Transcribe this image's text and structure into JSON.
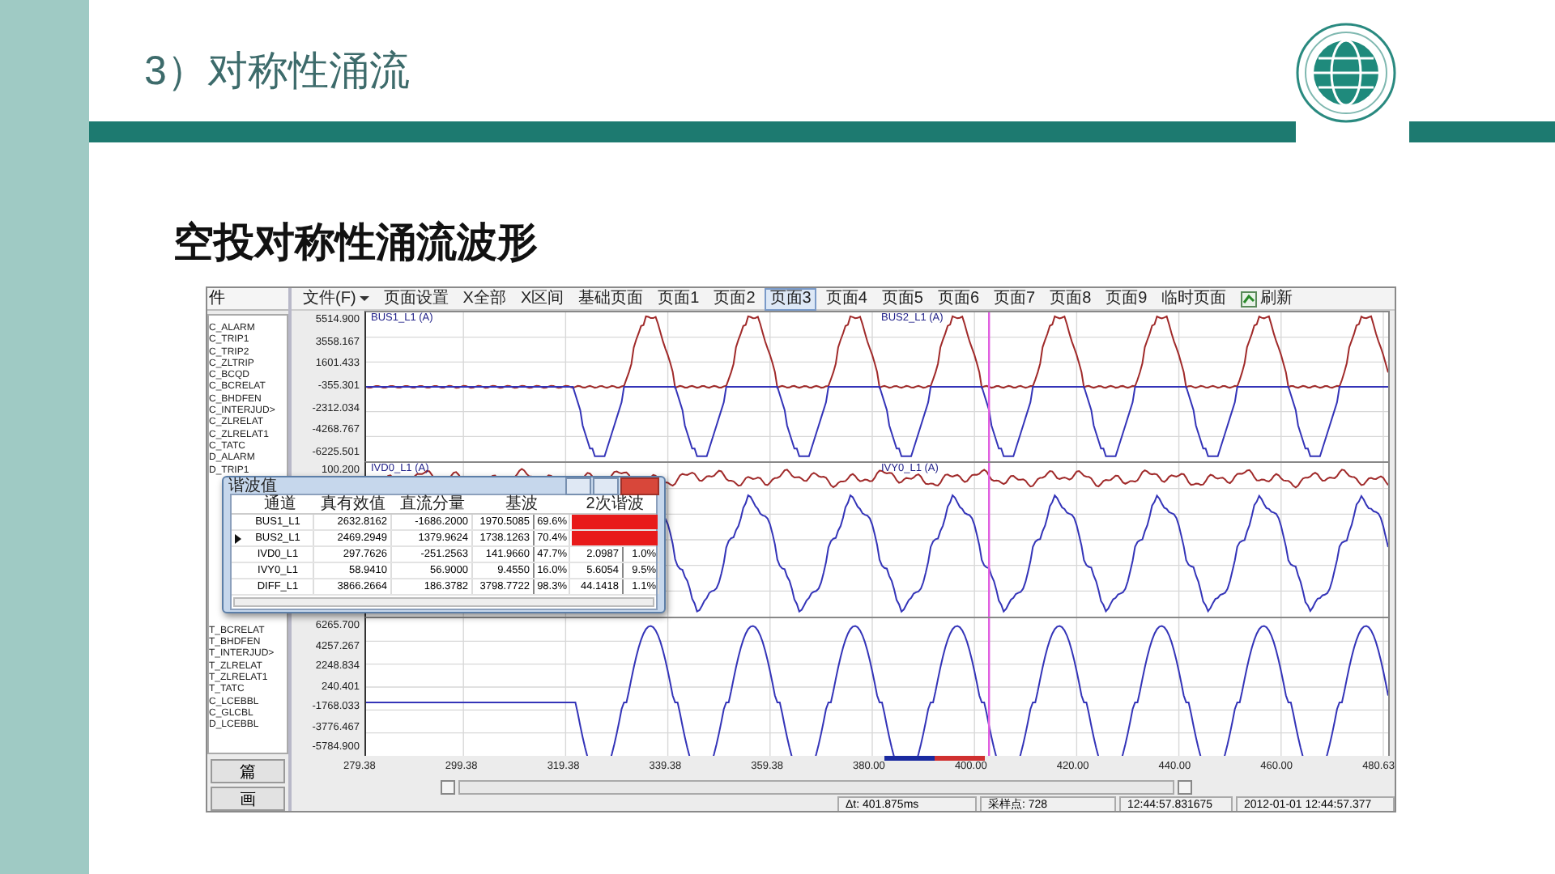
{
  "slide": {
    "title": "3）对称性涌流",
    "heading": "空投对称性涌流波形"
  },
  "app": {
    "side_header": "件",
    "channels": [
      "C_ALARM",
      "C_TRIP1",
      "C_TRIP2",
      "C_ZLTRIP",
      "C_BCQD",
      "C_BCRELAT",
      "C_BHDFEN",
      "C_INTERJUD>",
      "C_ZLRELAT",
      "C_ZLRELAT1",
      "C_TATC",
      "D_ALARM",
      "D_TRIP1",
      "T_BCRELAT",
      "T_BHDFEN",
      "T_INTERJUD>",
      "T_ZLRELAT",
      "T_ZLRELAT1",
      "T_TATC",
      "C_LCEBBL",
      "C_GLCBL",
      "D_LCEBBL"
    ],
    "side_buttons": [
      "篇",
      "画"
    ],
    "toolbar": [
      {
        "label": "文件(F)",
        "kind": "menu",
        "selected": false
      },
      {
        "label": "页面设置",
        "kind": "button",
        "selected": false
      },
      {
        "label": "X全部",
        "kind": "button",
        "selected": false
      },
      {
        "label": "X区间",
        "kind": "button",
        "selected": false
      },
      {
        "label": "基础页面",
        "kind": "button",
        "selected": false
      },
      {
        "label": "页面1",
        "kind": "button",
        "selected": false
      },
      {
        "label": "页面2",
        "kind": "button",
        "selected": false
      },
      {
        "label": "页面3",
        "kind": "button",
        "selected": true
      },
      {
        "label": "页面4",
        "kind": "button",
        "selected": false
      },
      {
        "label": "页面5",
        "kind": "button",
        "selected": false
      },
      {
        "label": "页面6",
        "kind": "button",
        "selected": false
      },
      {
        "label": "页面7",
        "kind": "button",
        "selected": false
      },
      {
        "label": "页面8",
        "kind": "button",
        "selected": false
      },
      {
        "label": "页面9",
        "kind": "button",
        "selected": false
      },
      {
        "label": "临时页面",
        "kind": "button",
        "selected": false
      },
      {
        "label": "刷新",
        "kind": "refresh",
        "selected": false
      }
    ],
    "panels": [
      {
        "kind": "stepped",
        "traces": [
          "BUS1_L1 (A)",
          "BUS2_L1 (A)"
        ],
        "yticks": [
          "5514.900",
          "3558.167",
          "1601.433",
          "-355.301",
          "-2312.034",
          "-4268.767",
          "-6225.501"
        ]
      },
      {
        "kind": "mixed",
        "traces": [
          "IVD0_L1 (A)",
          "IVY0_L1 (A)"
        ],
        "yticks": [
          "100.200"
        ]
      },
      {
        "kind": "sine",
        "yticks": [
          "6265.700",
          "4257.267",
          "2248.834",
          "240.401",
          "-1768.033",
          "-3776.467",
          "-5784.900"
        ]
      }
    ],
    "xticks": [
      "279.38",
      "299.38",
      "319.38",
      "339.38",
      "359.38",
      "380.00",
      "400.00",
      "420.00",
      "440.00",
      "460.00",
      "480.63"
    ],
    "status": [
      "Δt: 401.875ms",
      "采样点: 728",
      "12:44:57.831675",
      "2012-01-01 12:44:57.377"
    ],
    "dialog": {
      "title": "谐波值",
      "columns": [
        "通道",
        "真有效值",
        "直流分量",
        "基波",
        "2次谐波"
      ],
      "rows": [
        {
          "channel": "BUS1_L1",
          "rms": "2632.8162",
          "dc": "-1686.2000",
          "fundamental": "1970.5085",
          "fundamental_pct": "69.6%",
          "highlighted": true,
          "selected": false
        },
        {
          "channel": "BUS2_L1",
          "rms": "2469.2949",
          "dc": "1379.9624",
          "fundamental": "1738.1263",
          "fundamental_pct": "70.4%",
          "highlighted": true,
          "selected": true
        },
        {
          "channel": "IVD0_L1",
          "rms": "297.7626",
          "dc": "-251.2563",
          "fundamental": "141.9660",
          "fundamental_pct": "47.7%",
          "h2": "2.0987",
          "h2_pct": "1.0%",
          "highlighted": false,
          "selected": false
        },
        {
          "channel": "IVY0_L1",
          "rms": "58.9410",
          "dc": "56.9000",
          "fundamental": "9.4550",
          "fundamental_pct": "16.0%",
          "h2": "5.6054",
          "h2_pct": "9.5%",
          "highlighted": false,
          "selected": false
        },
        {
          "channel": "DIFF_L1",
          "rms": "3866.2664",
          "dc": "186.3782",
          "fundamental": "3798.7722",
          "fundamental_pct": "98.3%",
          "h2": "44.1418",
          "h2_pct": "1.1%",
          "highlighted": false,
          "selected": false
        }
      ]
    }
  }
}
